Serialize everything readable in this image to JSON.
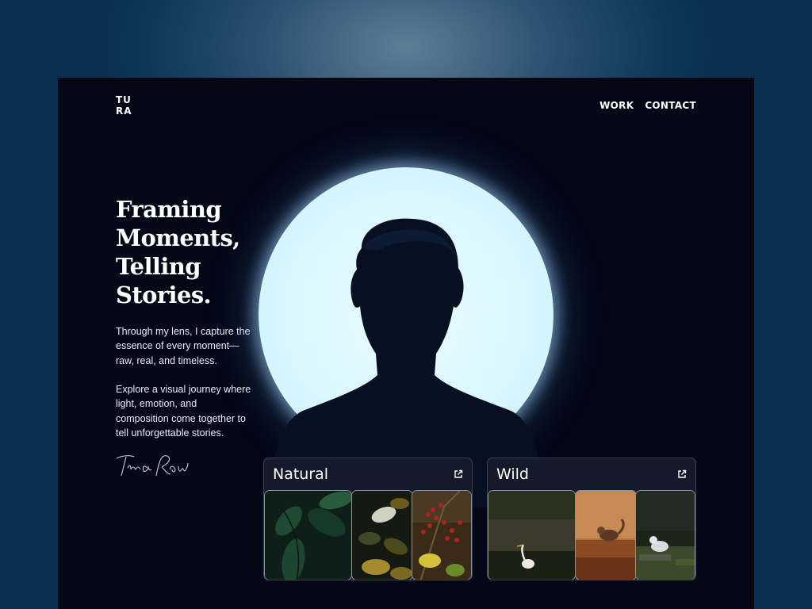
{
  "brand": {
    "logo_line1": "TU",
    "logo_line2": "RA"
  },
  "nav": {
    "items": [
      "WORK",
      "CONTACT"
    ]
  },
  "hero": {
    "title_lines": [
      "Framing",
      "Moments,",
      "Telling",
      "Stories."
    ],
    "paragraph1_lines": [
      "Through my lens, I capture the",
      "essence of every moment—",
      "raw, real, and timeless."
    ],
    "paragraph2_lines": [
      "Explore a visual journey where",
      "light, emotion, and",
      "composition come together to",
      "tell unforgettable stories."
    ],
    "signature": "Tura Row"
  },
  "cards": [
    {
      "title": "Natural",
      "icon": "external-link-icon",
      "images": [
        "green-leaves-photo",
        "dark-foliage-photo",
        "red-berries-photo"
      ]
    },
    {
      "title": "Wild",
      "icon": "external-link-icon",
      "images": [
        "egret-photo",
        "chipmunk-photo",
        "white-cat-photo"
      ]
    }
  ],
  "colors": {
    "page_bg": "#0d3556",
    "frame_bg": "#030716",
    "halo": "#e2f9ff",
    "card_bg": "#141a29"
  }
}
